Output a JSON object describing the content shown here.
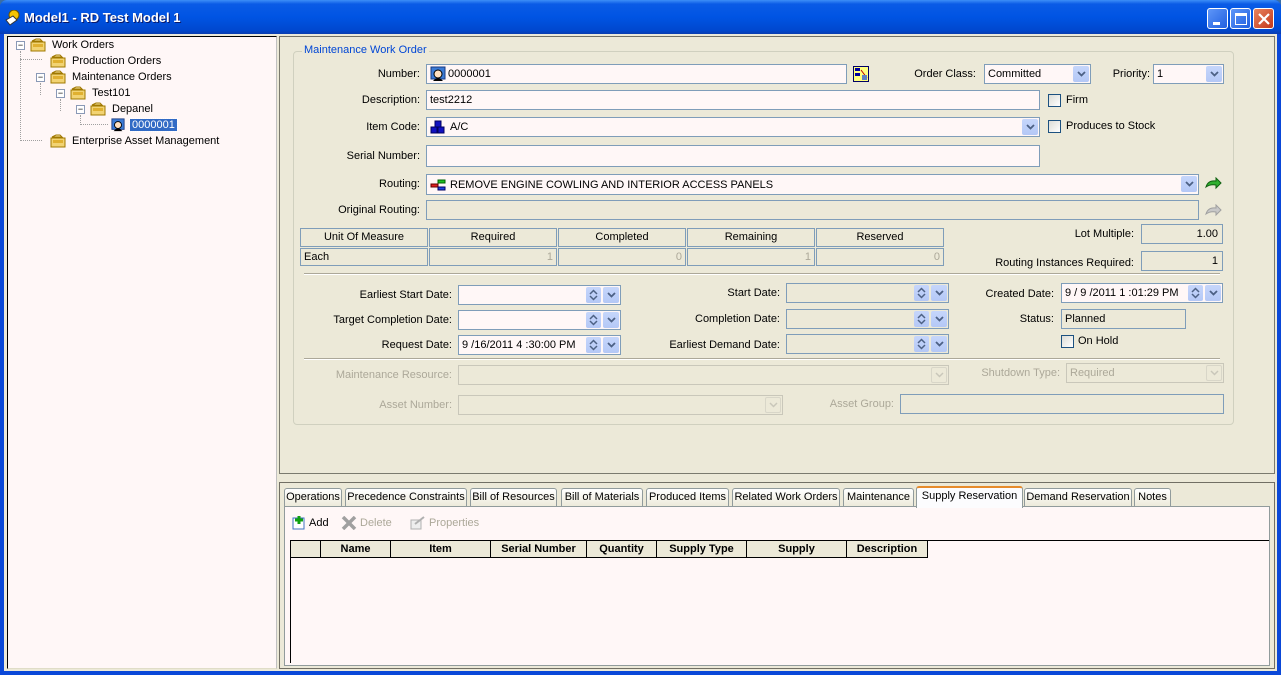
{
  "window": {
    "title": "Model1 - RD Test Model 1",
    "controls": {
      "minimize": "minimize",
      "maximize": "maximize",
      "close": "close"
    }
  },
  "tree": {
    "items": [
      {
        "label": "Work Orders",
        "icon": "folder-icon",
        "expanded": true
      },
      {
        "label": "Production Orders",
        "icon": "folder-icon"
      },
      {
        "label": "Maintenance Orders",
        "icon": "folder-icon",
        "expanded": true
      },
      {
        "label": "Test101",
        "icon": "folder-icon",
        "expanded": true
      },
      {
        "label": "Depanel",
        "icon": "folder-icon",
        "expanded": true
      },
      {
        "label": "0000001",
        "icon": "work-order-icon",
        "selected": true
      },
      {
        "label": "Enterprise Asset Management",
        "icon": "folder-icon"
      }
    ]
  },
  "form": {
    "group_title": "Maintenance Work Order",
    "number": {
      "label": "Number:",
      "value": "0000001"
    },
    "order_class": {
      "label": "Order Class:",
      "value": "Committed"
    },
    "priority": {
      "label": "Priority:",
      "value": "1"
    },
    "description": {
      "label": "Description:",
      "value": "test2212"
    },
    "firm": {
      "label": "Firm",
      "checked": false
    },
    "item_code": {
      "label": "Item Code:",
      "value": "A/C"
    },
    "produces_to_stock": {
      "label": "Produces to Stock",
      "checked": false
    },
    "serial_number": {
      "label": "Serial Number:",
      "value": ""
    },
    "routing": {
      "label": "Routing:",
      "value": "REMOVE ENGINE COWLING AND INTERIOR ACCESS PANELS"
    },
    "original_routing": {
      "label": "Original Routing:",
      "value": ""
    },
    "quantity_grid": {
      "headers": [
        "Unit Of Measure",
        "Required",
        "Completed",
        "Remaining",
        "Reserved"
      ],
      "row": [
        "Each",
        "1",
        "0",
        "1",
        "0"
      ]
    },
    "lot_multiple": {
      "label": "Lot Multiple:",
      "value": "1.00"
    },
    "routing_instances": {
      "label": "Routing Instances Required:",
      "value": "1"
    },
    "earliest_start_date": {
      "label": "Earliest Start Date:",
      "value": ""
    },
    "target_completion_date": {
      "label": "Target Completion Date:",
      "value": ""
    },
    "request_date": {
      "label": "Request Date:",
      "value": "9 /16/2011  4 :30:00 PM"
    },
    "start_date": {
      "label": "Start Date:",
      "value": ""
    },
    "completion_date": {
      "label": "Completion Date:",
      "value": ""
    },
    "earliest_demand_date": {
      "label": "Earliest Demand Date:",
      "value": ""
    },
    "created_date": {
      "label": "Created Date:",
      "value": "9 / 9 /2011  1 :01:29 PM"
    },
    "status": {
      "label": "Status:",
      "value": "Planned"
    },
    "on_hold": {
      "label": "On Hold",
      "checked": false
    },
    "maintenance_resource": {
      "label": "Maintenance Resource:",
      "value": ""
    },
    "shutdown_type": {
      "label": "Shutdown Type:",
      "value": "Required"
    },
    "asset_number": {
      "label": "Asset Number:",
      "value": ""
    },
    "asset_group": {
      "label": "Asset Group:",
      "value": ""
    }
  },
  "tabs": {
    "items": [
      {
        "label": "Operations"
      },
      {
        "label": "Precedence Constraints"
      },
      {
        "label": "Bill of Resources"
      },
      {
        "label": "Bill of Materials"
      },
      {
        "label": "Produced Items"
      },
      {
        "label": "Related Work Orders"
      },
      {
        "label": "Maintenance"
      },
      {
        "label": "Supply Reservation",
        "active": true
      },
      {
        "label": "Demand Reservation"
      },
      {
        "label": "Notes"
      }
    ]
  },
  "toolbar": {
    "add_label": "Add",
    "delete_label": "Delete",
    "properties_label": "Properties"
  },
  "reservation_table": {
    "columns": [
      "",
      "Name",
      "Item",
      "Serial Number",
      "Quantity",
      "Supply Type",
      "Supply",
      "Description"
    ],
    "rows": []
  },
  "colors": {
    "titlebar": "#0054e3",
    "selection": "#316ac5",
    "group_title": "#0046d5",
    "active_tab_accent": "#e68b2c",
    "panel_bg": "#ece9d8"
  }
}
